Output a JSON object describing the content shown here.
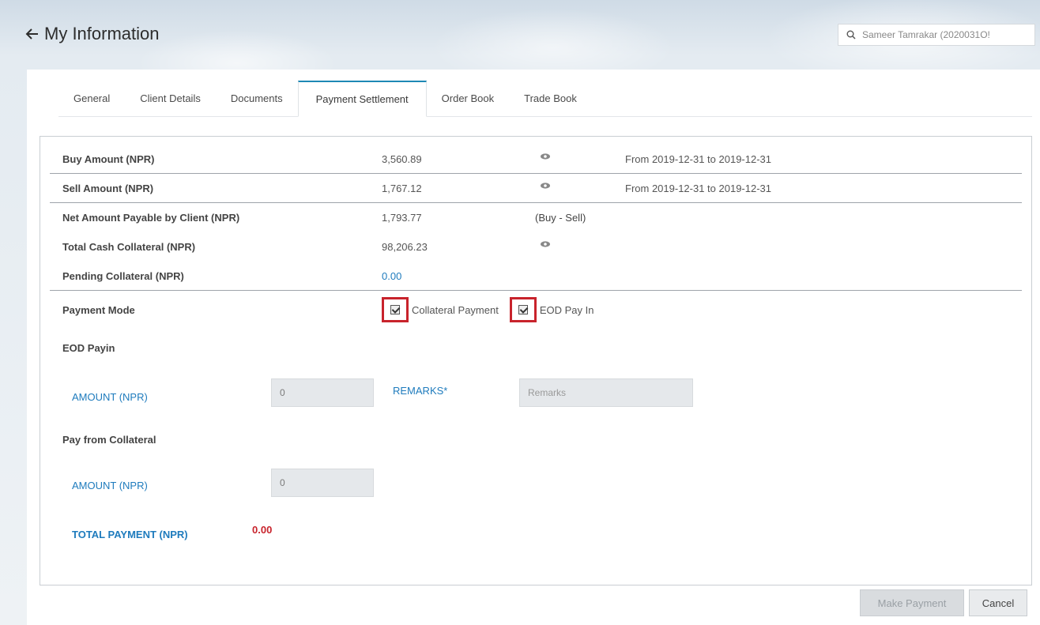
{
  "header": {
    "title": "My Information",
    "search_value": "Sameer Tamrakar (2020031O!"
  },
  "tabs": [
    {
      "label": "General"
    },
    {
      "label": "Client Details"
    },
    {
      "label": "Documents"
    },
    {
      "label": "Payment Settlement"
    },
    {
      "label": "Order Book"
    },
    {
      "label": "Trade Book"
    }
  ],
  "rows": {
    "buy": {
      "label": "Buy Amount (NPR)",
      "value": "3,560.89",
      "range": "From 2019-12-31 to 2019-12-31"
    },
    "sell": {
      "label": "Sell Amount (NPR)",
      "value": "1,767.12",
      "range": "From 2019-12-31 to 2019-12-31"
    },
    "net": {
      "label": "Net Amount Payable by Client (NPR)",
      "value": "1,793.77",
      "note": "(Buy - Sell)"
    },
    "cash": {
      "label": "Total Cash Collateral (NPR)",
      "value": "98,206.23"
    },
    "pending": {
      "label": "Pending Collateral (NPR)",
      "value": "0.00"
    }
  },
  "payment_mode": {
    "label": "Payment Mode",
    "option1": "Collateral Payment",
    "option2": "EOD Pay In"
  },
  "eod": {
    "title": "EOD Payin",
    "amount_label": "AMOUNT (NPR)",
    "amount_value": "0",
    "remarks_label": "REMARKS*",
    "remarks_placeholder": "Remarks"
  },
  "collateral": {
    "title": "Pay from Collateral",
    "amount_label": "AMOUNT (NPR)",
    "amount_value": "0"
  },
  "total": {
    "label": "TOTAL PAYMENT (NPR)",
    "value": "0.00"
  },
  "buttons": {
    "make_payment": "Make Payment",
    "cancel": "Cancel"
  },
  "colors": {
    "accent": "#1e7bbd",
    "highlight": "#c8232c"
  },
  "icons": [
    "back-arrow-icon",
    "search-icon",
    "eye-icon",
    "checkbox-checked-icon"
  ]
}
